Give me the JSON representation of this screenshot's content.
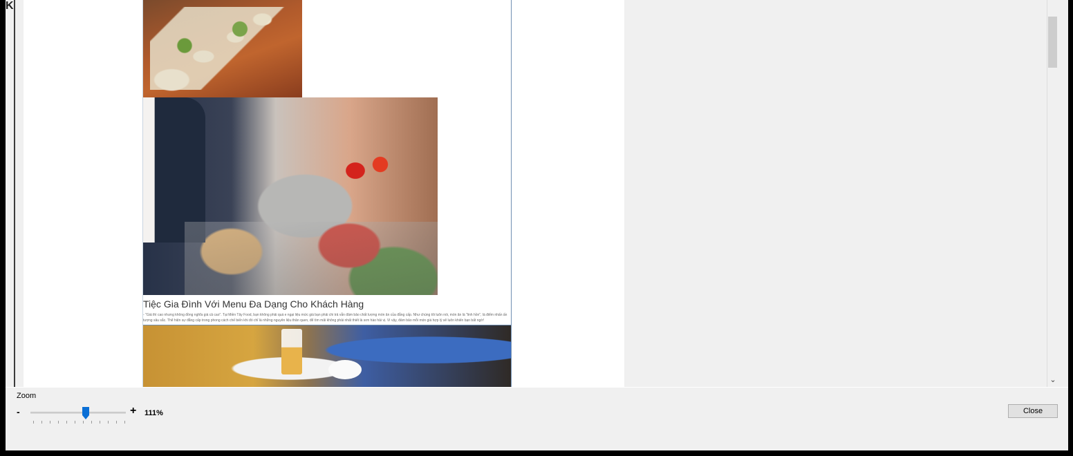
{
  "document": {
    "heading": "Tiệc Gia Đình Với Menu Đa Dạng Cho Khách Hàng",
    "body": "- \"Giá thì cao nhưng không đồng nghĩa giá cả cao\". Tại Miền Tây Food, bạn không phải quá e ngại liệu mức giá bạn phải chi trả vẫn đảm bảo chất lượng món ăn của đẳng cấp. Như chúng tôi luôn nói, món ăn là \"linh hồn\", là điểm nhấn ấn tượng sâu sắc. Thể hiện sự đẳng cấp trong phong cách chế biến khi đó chỉ là những nguyên liệu thân quen, để tìm mãi không phải nhất thiết là sơn hào hải vị. Vì vậy, đảm bảo mỗi món giá hợp lý sẽ luôn khiến bạn bất ngờ!"
  },
  "zoom": {
    "label": "Zoom",
    "minus": "-",
    "plus": "+",
    "value": "111%",
    "level_fraction": 0.58
  },
  "buttons": {
    "close": "Close"
  },
  "icons": {
    "scroll_down": "chevron-down-icon"
  }
}
